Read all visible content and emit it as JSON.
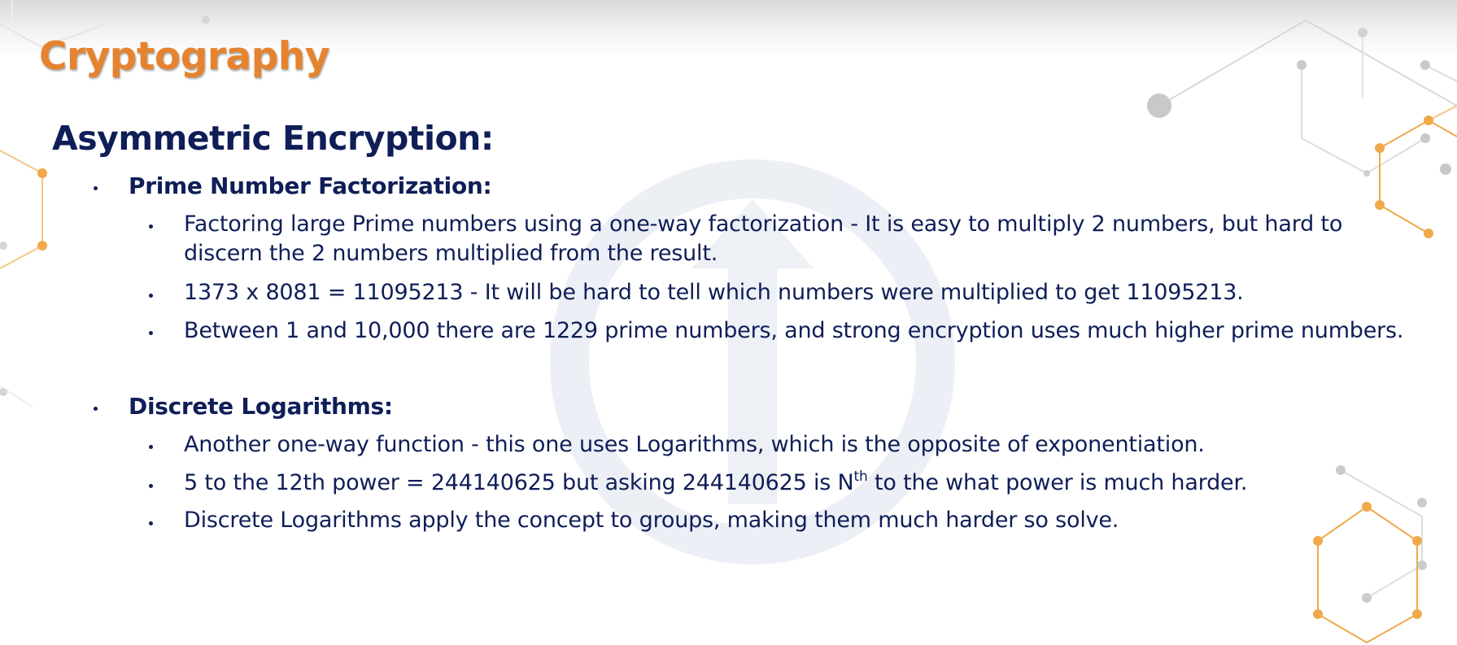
{
  "slide": {
    "title": "Cryptography",
    "heading": "Asymmetric Encryption:",
    "sections": [
      {
        "title": "Prime Number Factorization:",
        "points": [
          "Factoring large Prime numbers using a one-way factorization - It is easy to multiply 2 numbers, but hard to discern the 2 numbers multiplied from the result.",
          "1373 x 8081 = 11095213 - It will be hard to tell which numbers were multiplied to get 11095213.",
          "Between 1 and 10,000 there are 1229 prime numbers, and strong encryption uses much higher prime numbers."
        ]
      },
      {
        "title": "Discrete Logarithms:",
        "points": [
          "Another one-way function - this one uses Logarithms, which is the opposite of exponentiation.",
          {
            "before": "5 to the 12th power = 244140625 but asking 244140625 is N",
            "sup": "th",
            "after": " to the what power is much harder."
          },
          "Discrete Logarithms apply the concept to groups, making them much harder so solve."
        ]
      }
    ]
  },
  "colors": {
    "title": "#e5832f",
    "text": "#0f1e57",
    "accent_orange": "#f0a94a",
    "watermark": "#e4e8f0"
  }
}
